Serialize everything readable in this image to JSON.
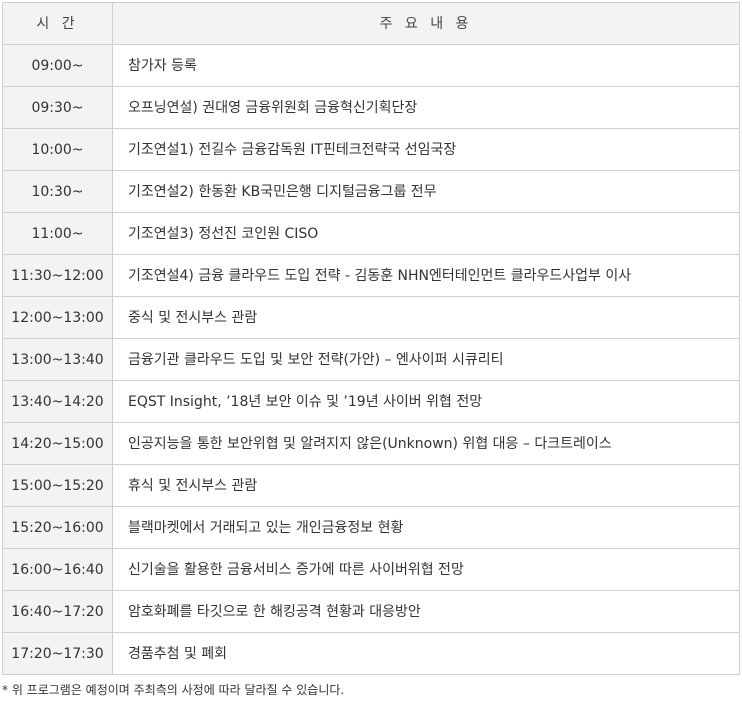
{
  "table": {
    "headers": {
      "time": "시 간",
      "content": "주 요 내 용"
    },
    "rows": [
      {
        "time": "09:00~",
        "content": "참가자 등록"
      },
      {
        "time": "09:30~",
        "content": "오프닝연설) 권대영 금융위원회 금융혁신기획단장"
      },
      {
        "time": "10:00~",
        "content": "기조연설1) 전길수 금융감독원 IT핀테크전략국 선임국장"
      },
      {
        "time": "10:30~",
        "content": "기조연설2) 한동환 KB국민은행 디지털금융그룹 전무"
      },
      {
        "time": "11:00~",
        "content": "기조연설3) 정선진 코인원 CISO"
      },
      {
        "time": "11:30~12:00",
        "content": "기조연설4) 금융 클라우드 도입 전략 - 김동훈 NHN엔터테인먼트 클라우드사업부 이사"
      },
      {
        "time": "12:00~13:00",
        "content": "중식 및 전시부스 관람"
      },
      {
        "time": "13:00~13:40",
        "content": "금융기관 클라우드 도입 및 보안 전략(가안) – 엔사이퍼 시큐리티"
      },
      {
        "time": "13:40~14:20",
        "content": "EQST Insight, ’18년 보안 이슈 및 ’19년 사이버 위협 전망"
      },
      {
        "time": "14:20~15:00",
        "content": "인공지능을 통한 보안위협 및 알려지지 않은(Unknown) 위협 대응 – 다크트레이스"
      },
      {
        "time": "15:00~15:20",
        "content": "휴식 및 전시부스 관람"
      },
      {
        "time": "15:20~16:00",
        "content": "블랙마켓에서 거래되고 있는 개인금융정보 현황"
      },
      {
        "time": "16:00~16:40",
        "content": "신기술을 활용한 금융서비스 증가에 따른 사이버위협 전망"
      },
      {
        "time": "16:40~17:20",
        "content": "암호화폐를 타깃으로 한 해킹공격 현황과 대응방안"
      },
      {
        "time": "17:20~17:30",
        "content": "경품추첨 및 폐회"
      }
    ]
  },
  "footnote": "* 위 프로그램은 예정이며 주최측의 사정에 따라 달라질 수 있습니다."
}
